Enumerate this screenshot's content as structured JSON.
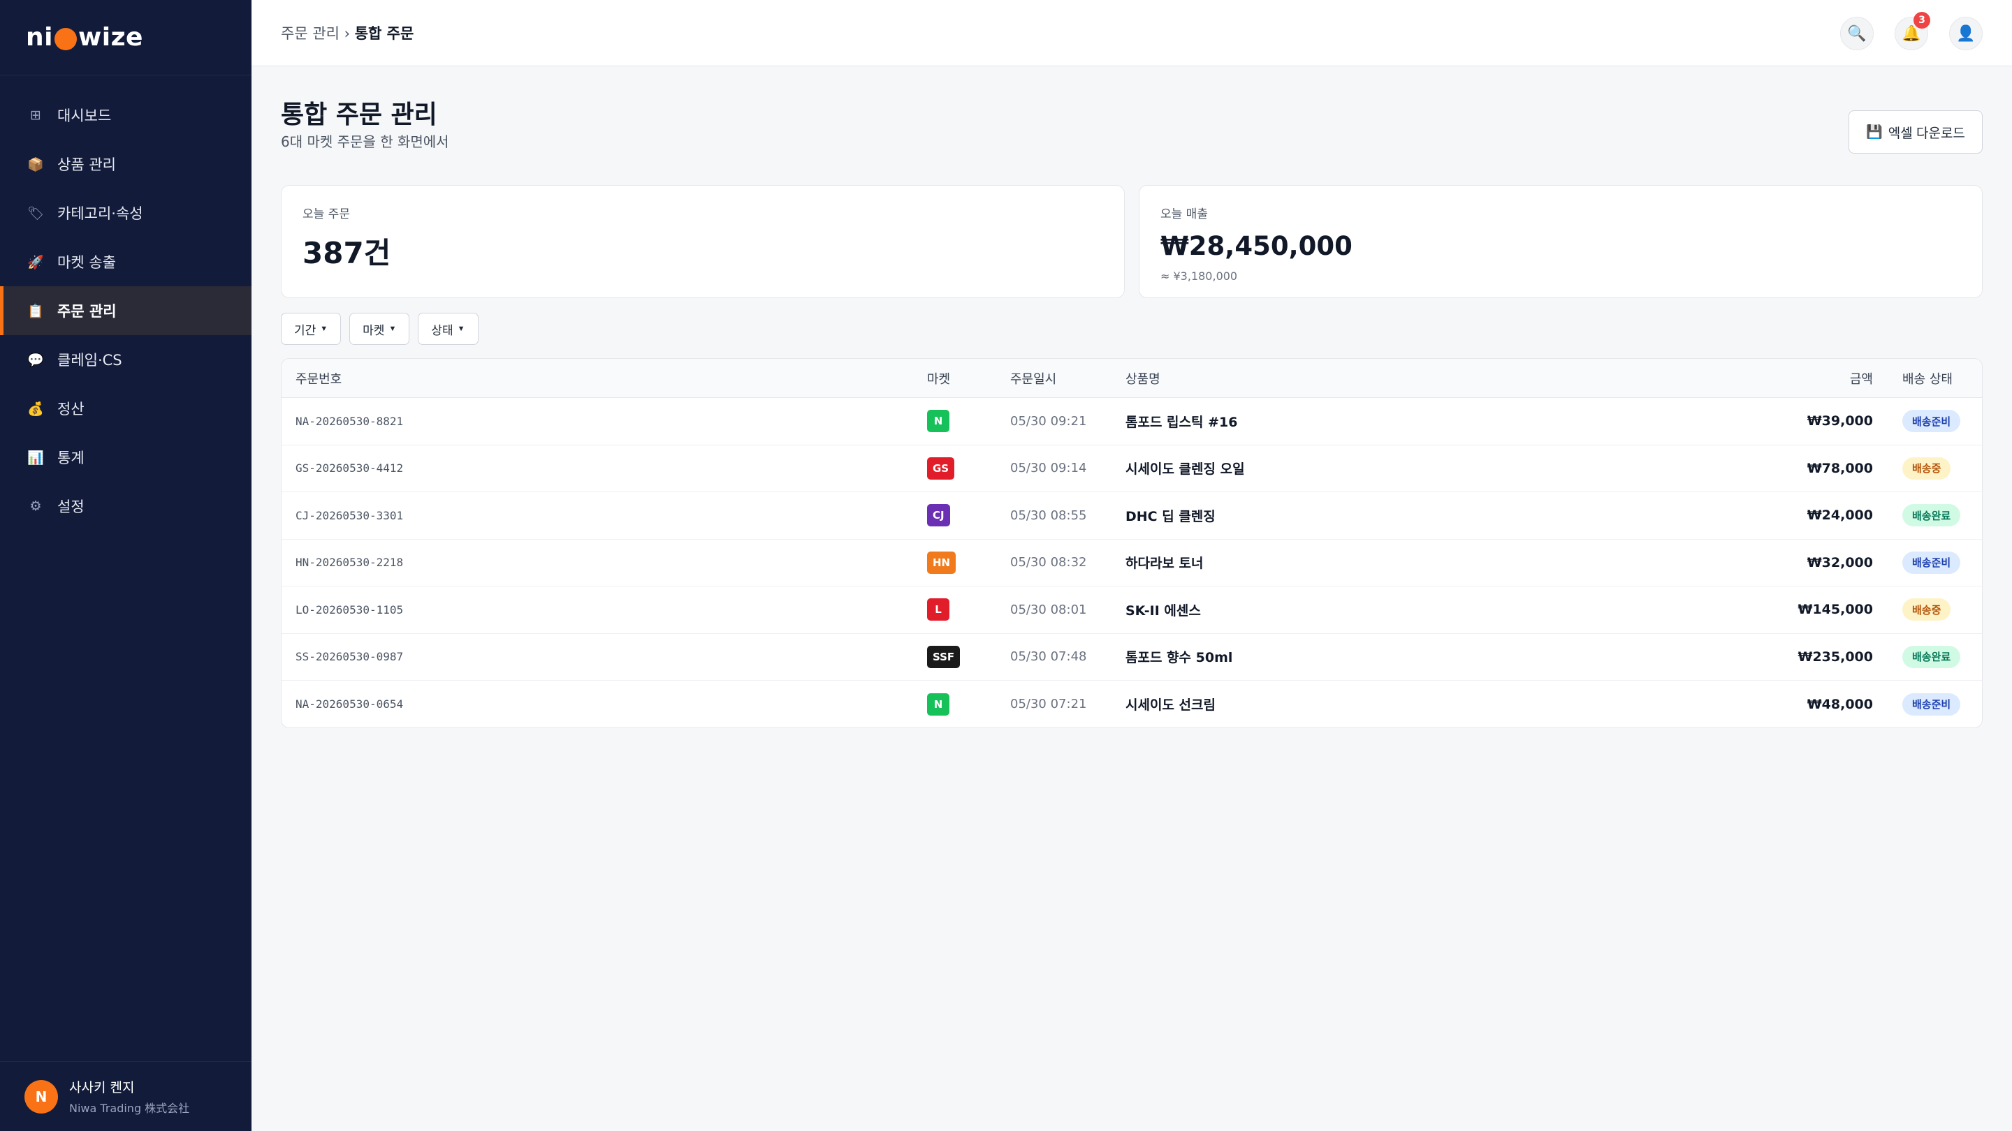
{
  "logo": {
    "part1": "ni",
    "part2": "wize"
  },
  "sidebar": {
    "items": [
      {
        "icon": "grid-icon",
        "glyph": "⊞",
        "label": "대시보드"
      },
      {
        "icon": "box-icon",
        "glyph": "📦",
        "label": "상품 관리"
      },
      {
        "icon": "tag-icon",
        "glyph": "🏷",
        "label": "카테고리·속성"
      },
      {
        "icon": "rocket-icon",
        "glyph": "🚀",
        "label": "마켓 송출"
      },
      {
        "icon": "clipboard-icon",
        "glyph": "📋",
        "label": "주문 관리"
      },
      {
        "icon": "chat-icon",
        "glyph": "💬",
        "label": "클레임·CS"
      },
      {
        "icon": "money-bag-icon",
        "glyph": "💰",
        "label": "정산"
      },
      {
        "icon": "bar-chart-icon",
        "glyph": "📊",
        "label": "통계"
      },
      {
        "icon": "gear-icon",
        "glyph": "⚙",
        "label": "설정"
      }
    ],
    "active_index": 4,
    "user": {
      "initial": "N",
      "name": "사사키 켄지",
      "company": "Niwa Trading 株式会社"
    }
  },
  "header": {
    "breadcrumb_parent": "주문 관리",
    "breadcrumb_sep": " › ",
    "breadcrumb_current": "통합 주문",
    "notification_count": "3"
  },
  "main": {
    "title": "통합 주문 관리",
    "subtitle": "6대 마켓 주문을 한 화면에서",
    "excel_button": "엑셀 다운로드",
    "stats": {
      "orders_label": "오늘 주문",
      "orders_value": "387건",
      "sales_label": "오늘 매출",
      "sales_value": "₩28,450,000",
      "sales_sub": "≈ ¥3,180,000"
    },
    "filters": [
      "기간",
      "마켓",
      "상태"
    ],
    "table": {
      "columns": [
        "주문번호",
        "마켓",
        "주문일시",
        "상품명",
        "금액",
        "배송 상태"
      ],
      "rows": [
        {
          "id": "NA-20260530-8821",
          "market": "N",
          "market_color": "#16c15a",
          "date": "05/30 09:21",
          "product": "톰포드 립스틱 #16",
          "amount": "₩39,000",
          "status": "배송준비",
          "status_type": "ready"
        },
        {
          "id": "GS-20260530-4412",
          "market": "GS",
          "market_color": "#e11d2a",
          "date": "05/30 09:14",
          "product": "시세이도 클렌징 오일",
          "amount": "₩78,000",
          "status": "배송중",
          "status_type": "shipping"
        },
        {
          "id": "CJ-20260530-3301",
          "market": "CJ",
          "market_color": "#6b2fb3",
          "date": "05/30 08:55",
          "product": "DHC 딥 클렌징",
          "amount": "₩24,000",
          "status": "배송완료",
          "status_type": "done"
        },
        {
          "id": "HN-20260530-2218",
          "market": "HN",
          "market_color": "#f07a1c",
          "date": "05/30 08:32",
          "product": "하다라보 토너",
          "amount": "₩32,000",
          "status": "배송준비",
          "status_type": "ready"
        },
        {
          "id": "LO-20260530-1105",
          "market": "L",
          "market_color": "#e11d2a",
          "date": "05/30 08:01",
          "product": "SK-II 에센스",
          "amount": "₩145,000",
          "status": "배송중",
          "status_type": "shipping"
        },
        {
          "id": "SS-20260530-0987",
          "market": "SSF",
          "market_color": "#1a1a1a",
          "date": "05/30 07:48",
          "product": "톰포드 향수 50ml",
          "amount": "₩235,000",
          "status": "배송완료",
          "status_type": "done"
        },
        {
          "id": "NA-20260530-0654",
          "market": "N",
          "market_color": "#16c15a",
          "date": "05/30 07:21",
          "product": "시세이도 선크림",
          "amount": "₩48,000",
          "status": "배송준비",
          "status_type": "ready"
        }
      ]
    }
  },
  "colors": {
    "accent": "#f97316",
    "sidebar_bg": "#121c3a"
  }
}
